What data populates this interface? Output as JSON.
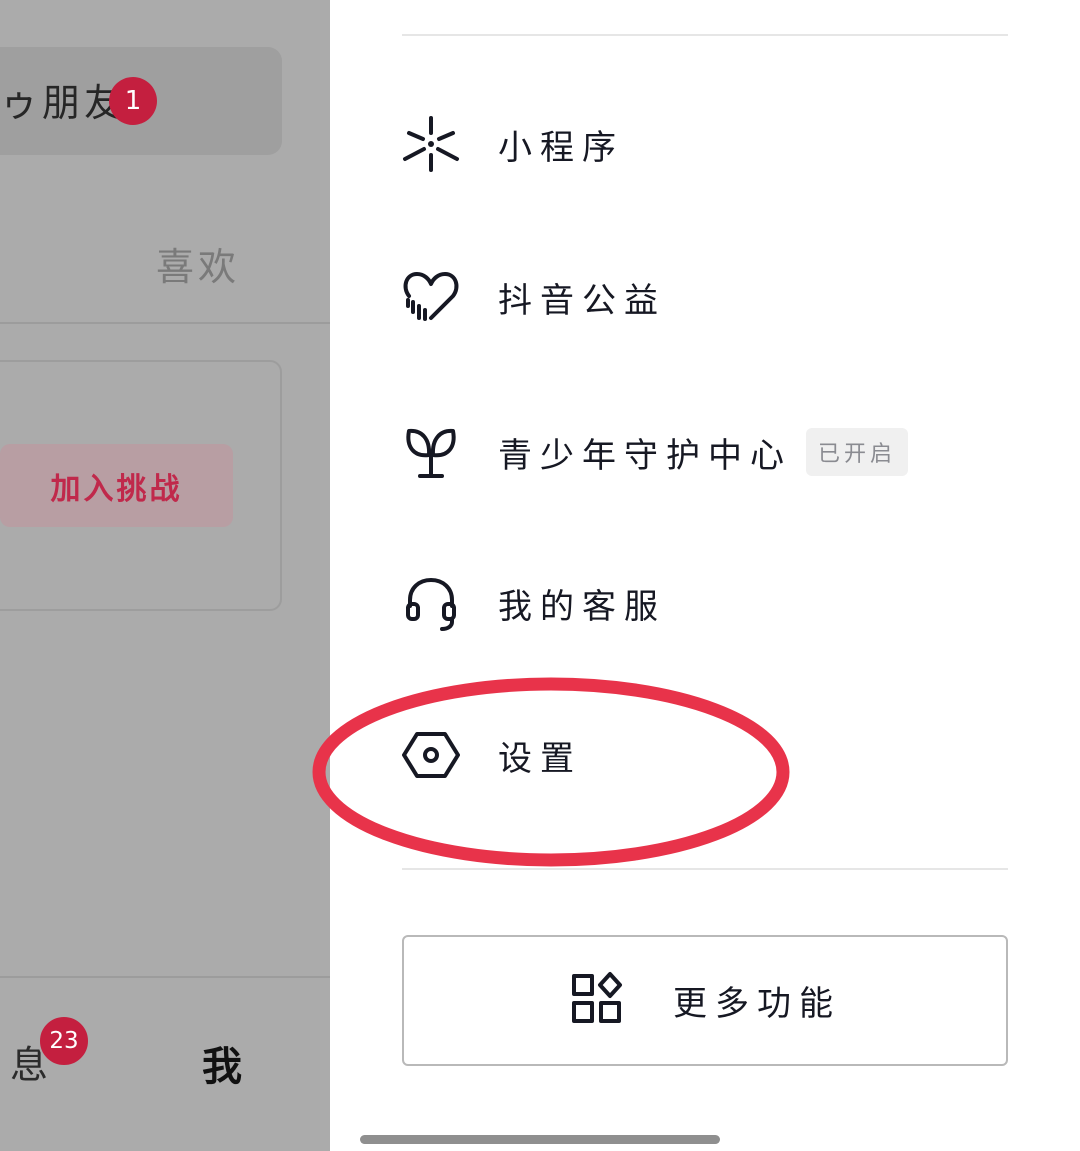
{
  "background_page": {
    "friend_label": "ゥ朋友",
    "friend_badge": "1",
    "tab_like": "喜欢",
    "join_button": "加入挑战",
    "nav_messages_label": "息",
    "nav_messages_badge": "23",
    "nav_me_label": "我"
  },
  "drawer": {
    "items": [
      {
        "icon": "mini-program-icon",
        "label": "小程序"
      },
      {
        "icon": "charity-heart-icon",
        "label": "抖音公益"
      },
      {
        "icon": "sprout-icon",
        "label": "青少年守护中心",
        "tag": "已开启"
      },
      {
        "icon": "headset-icon",
        "label": "我的客服"
      },
      {
        "icon": "settings-hexagon-icon",
        "label": "设置"
      }
    ],
    "more_button": {
      "icon": "grid-apps-icon",
      "label": "更多功能"
    }
  },
  "colors": {
    "accent_red": "#c41f3f",
    "annotation_red": "#e8334a",
    "overlay_gray": "#ababab"
  }
}
